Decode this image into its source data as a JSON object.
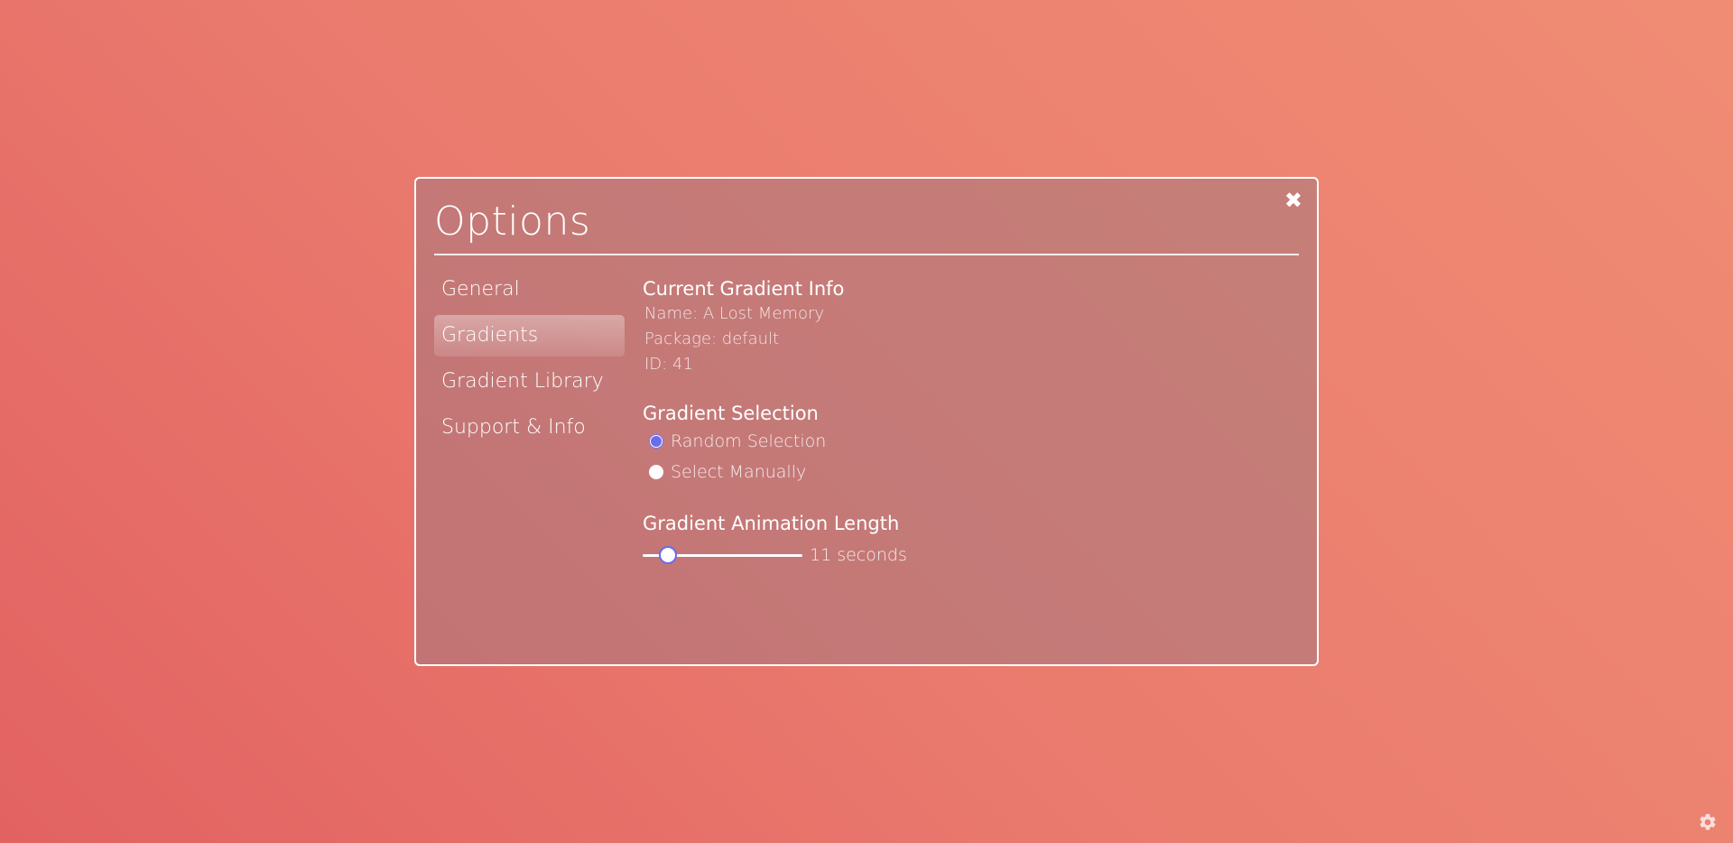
{
  "modal": {
    "title": "Options",
    "close_label": "✖"
  },
  "sidebar": {
    "items": [
      {
        "label": "General",
        "active": false
      },
      {
        "label": "Gradients",
        "active": true
      },
      {
        "label": "Gradient Library",
        "active": false
      },
      {
        "label": "Support & Info",
        "active": false
      }
    ]
  },
  "current_gradient": {
    "heading": "Current Gradient Info",
    "name": "Name: A Lost Memory",
    "package": "Package: default",
    "id": "ID: 41"
  },
  "gradient_selection": {
    "heading": "Gradient Selection",
    "options": [
      {
        "label": "Random Selection",
        "checked": true
      },
      {
        "label": "Select Manually",
        "checked": false
      }
    ]
  },
  "animation_length": {
    "heading": "Gradient Animation Length",
    "value_label": "11 seconds",
    "slider_fraction": 0.16
  },
  "colors": {
    "accent": "#6c6ce8",
    "background_start": "#e26262",
    "background_end": "#f08c74"
  },
  "icons": {
    "close": "close-icon",
    "settings": "gear-icon"
  }
}
